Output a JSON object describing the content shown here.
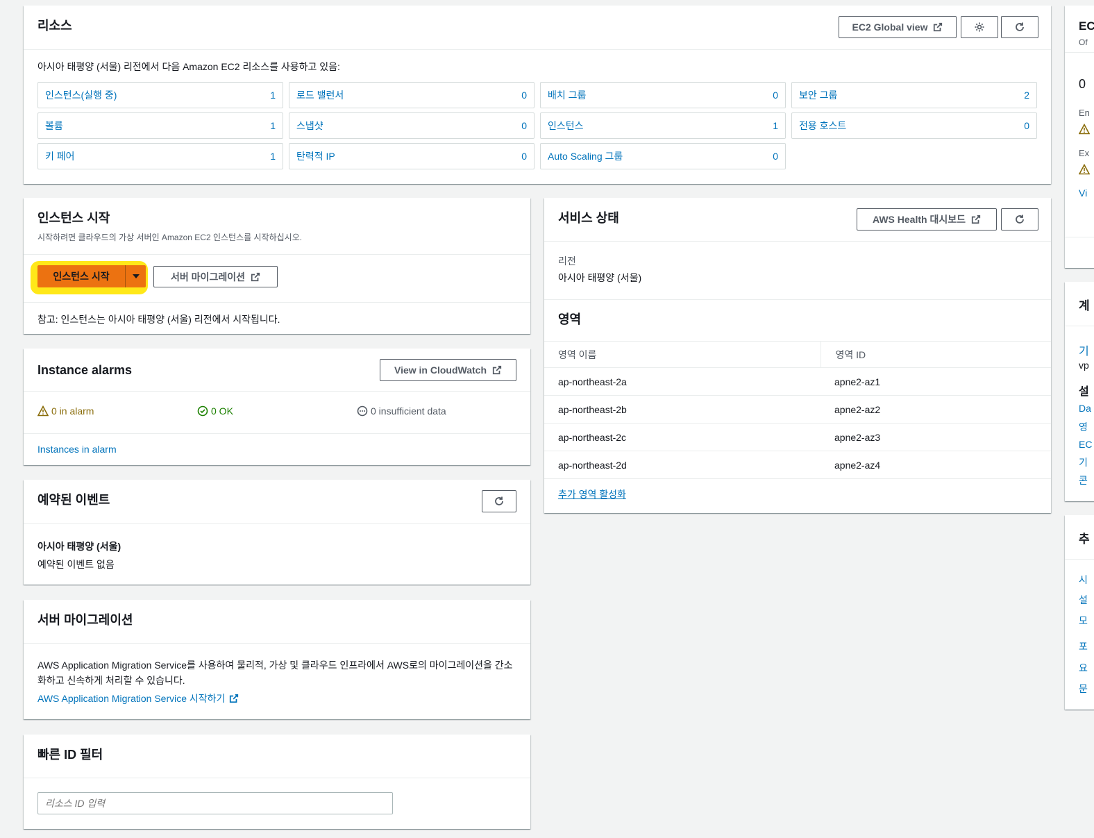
{
  "resources": {
    "title": "리소스",
    "global_view_label": "EC2 Global view",
    "description": "아시아 태평양 (서울) 리전에서 다음 Amazon EC2 리소스를 사용하고 있음:",
    "items": [
      {
        "label": "인스턴스(실행 중)",
        "count": "1"
      },
      {
        "label": "로드 밸런서",
        "count": "0"
      },
      {
        "label": "배치 그룹",
        "count": "0"
      },
      {
        "label": "보안 그룹",
        "count": "2"
      },
      {
        "label": "볼륨",
        "count": "1"
      },
      {
        "label": "스냅샷",
        "count": "0"
      },
      {
        "label": "인스턴스",
        "count": "1"
      },
      {
        "label": "전용 호스트",
        "count": "0"
      },
      {
        "label": "키 페어",
        "count": "1"
      },
      {
        "label": "탄력적 IP",
        "count": "0"
      },
      {
        "label": "Auto Scaling 그룹",
        "count": "0"
      }
    ]
  },
  "launch": {
    "title": "인스턴스 시작",
    "description": "시작하려면 클라우드의 가상 서버인 Amazon EC2 인스턴스를 시작하십시오.",
    "launch_button": "인스턴스 시작",
    "migration_button": "서버 마이그레이션",
    "note": "참고: 인스턴스는 아시아 태평양 (서울) 리전에서 시작됩니다."
  },
  "alarms": {
    "title": "Instance alarms",
    "cloudwatch_button": "View in CloudWatch",
    "in_alarm": "0 in alarm",
    "ok": "0 OK",
    "insufficient": "0 insufficient data",
    "link": "Instances in alarm"
  },
  "events": {
    "title": "예약된 이벤트",
    "region": "아시아 태평양 (서울)",
    "empty": "예약된 이벤트 없음"
  },
  "migration": {
    "title": "서버 마이그레이션",
    "text": "AWS Application Migration Service를 사용하여 물리적, 가상 및 클라우드 인프라에서 AWS로의 마이그레이션을 간소화하고 신속하게 처리할 수 있습니다.",
    "link": "AWS Application Migration Service 시작하기"
  },
  "quick_filter": {
    "title": "빠른 ID 필터",
    "placeholder": "리소스 ID 입력"
  },
  "service_health": {
    "title": "서비스 상태",
    "dashboard_button": "AWS Health 대시보드",
    "region_label": "리전",
    "region_value": "아시아 태평양 (서울)",
    "zones_title": "영역",
    "col_name": "영역 이름",
    "col_id": "영역 ID",
    "zones": [
      {
        "name": "ap-northeast-2a",
        "id": "apne2-az1"
      },
      {
        "name": "ap-northeast-2b",
        "id": "apne2-az2"
      },
      {
        "name": "ap-northeast-2c",
        "id": "apne2-az3"
      },
      {
        "name": "ap-northeast-2d",
        "id": "apne2-az4"
      }
    ],
    "enable_link": "추가 영역 활성화"
  },
  "side": {
    "top_title": "EC",
    "top_sub": "Of",
    "count": "0",
    "en": "En",
    "ex": "Ex",
    "vi": "Vi",
    "mid_title": "계",
    "gi": "기",
    "vp": "vp",
    "seol": "설",
    "da": "Da",
    "yeong": "영",
    "ec": "EC",
    "gi2": "기",
    "kon": "콘",
    "bottom_title": "추",
    "si": "시",
    "seol2": "설",
    "mo": "모",
    "po": "포",
    "yo": "요",
    "mun": "문"
  },
  "colors": {
    "primary": "#ec7211",
    "link": "#0073bb",
    "warning": "#8a6d0b",
    "ok": "#1d8102",
    "highlight": "#ffe500"
  }
}
